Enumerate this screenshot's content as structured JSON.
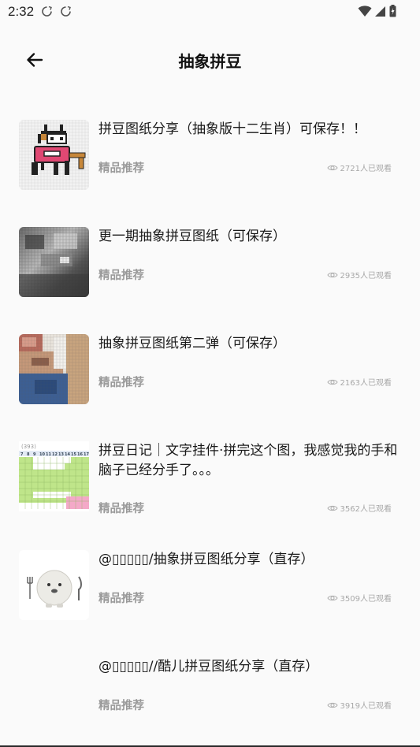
{
  "status_bar": {
    "time": "2:32",
    "notification_icons": [
      "sync-icon",
      "sync-icon"
    ],
    "right_icons": [
      "wifi-icon",
      "signal-icon",
      "battery-icon"
    ]
  },
  "app_bar": {
    "back_icon": "arrow-left-icon",
    "title": "抽象拼豆"
  },
  "articles": [
    {
      "title": "拼豆图纸分享（抽象版十二生肖）可保存！！",
      "tag": "精品推荐",
      "views": "2721人已观看",
      "thumb": "pixel-ox"
    },
    {
      "title": "更一期抽象拼豆图纸（可保存）",
      "tag": "精品推荐",
      "views": "2935人已观看",
      "thumb": "pixel-gray-photo"
    },
    {
      "title": "抽象拼豆图纸第二弹（可保存）",
      "tag": "精品推荐",
      "views": "2163人已观看",
      "thumb": "pixel-portrait"
    },
    {
      "title": "拼豆日记｜文字挂件·拼完这个图，我感觉我的手和脑子已经分手了。。。",
      "tag": "精品推荐",
      "views": "3562人已观看",
      "thumb": "bead-grid-chart"
    },
    {
      "title": "@▯▯▯▯▯/抽象拼豆图纸分享（直存）",
      "tag": "精品推荐",
      "views": "3509人已观看",
      "thumb": "seal-with-cutlery"
    },
    {
      "title": "@▯▯▯▯▯//酷儿拼豆图纸分享（直存）",
      "tag": "精品推荐",
      "views": "3919人已观看",
      "thumb": "none"
    }
  ],
  "grid_thumb": {
    "counter": "(393)",
    "columns": [
      "7",
      "8",
      "9",
      "10",
      "11",
      "12",
      "13",
      "14",
      "15",
      "16",
      "17"
    ]
  },
  "colors": {
    "background": "#fafafa",
    "tag": "#9a9a9a",
    "views": "#a8a8a8"
  }
}
